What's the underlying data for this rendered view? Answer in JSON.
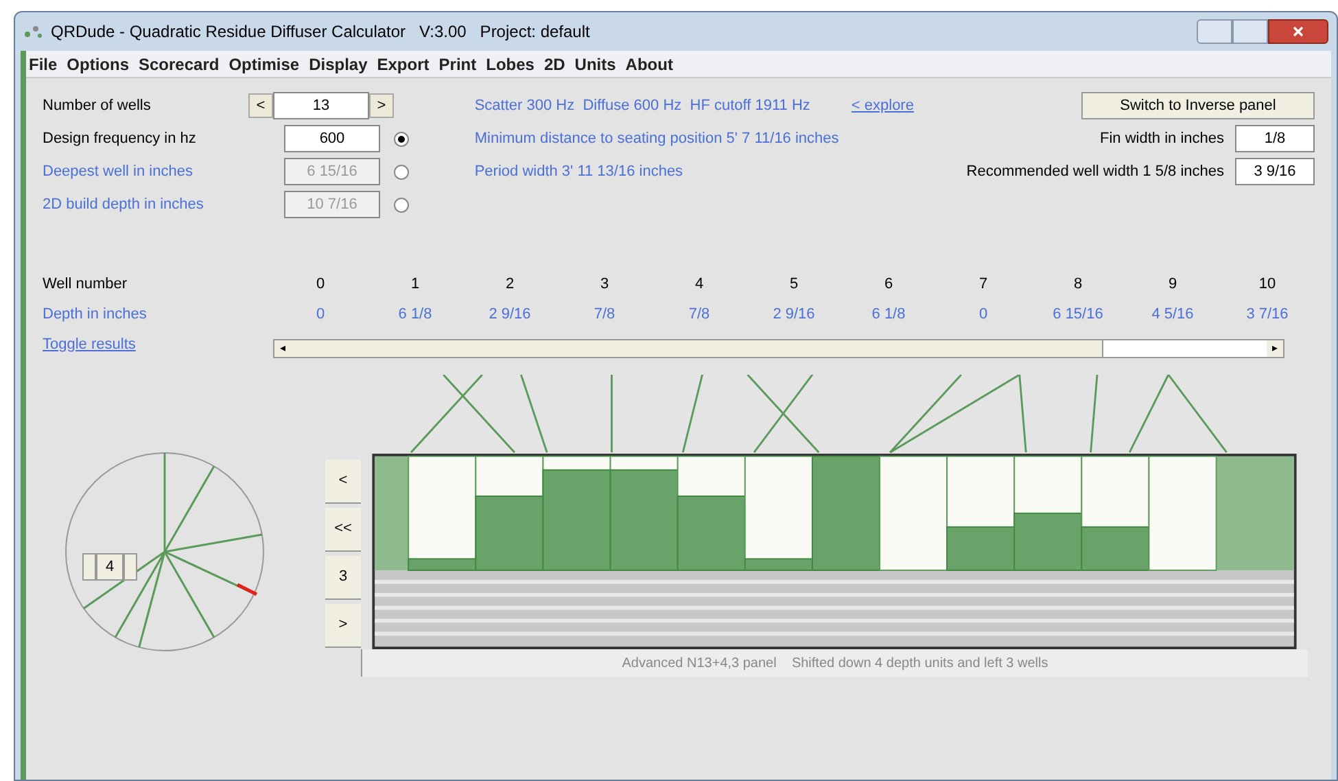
{
  "window": {
    "title": "QRDude - Quadratic Residue Diffuser Calculator   V:3.00   Project: default"
  },
  "menu": [
    "File",
    "Options",
    "Scorecard",
    "Optimise",
    "Display",
    "Export",
    "Print",
    "Lobes",
    "2D",
    "Units",
    "About"
  ],
  "fields": [
    {
      "kind": "spinner",
      "label": "Number of wells",
      "value": "13",
      "dec": "<",
      "inc": ">"
    },
    {
      "kind": "radio",
      "label": "Design frequency in hz",
      "value": "600",
      "selected": true,
      "disabled": false
    },
    {
      "kind": "radio",
      "label": "Deepest well in inches",
      "value": "6 15/16",
      "selected": false,
      "disabled": true
    },
    {
      "kind": "radio",
      "label": "2D build depth in inches",
      "value": "10 7/16",
      "selected": false,
      "disabled": true
    }
  ],
  "info": {
    "frequencies": "Scatter 300 Hz  Diffuse 600 Hz  HF cutoff 1911 Hz",
    "explore_link": "< explore",
    "min_distance": "Minimum distance to seating position 5' 7 11/16 inches",
    "period_width": "Period width 3' 11 13/16 inches"
  },
  "switch_button": "Switch to Inverse panel",
  "fin_width": {
    "label": "Fin width in inches",
    "value": "1/8"
  },
  "well_width": {
    "label": "Recommended well width 1 5/8 inches",
    "value": "3 9/16"
  },
  "wells": {
    "number_label": "Well number",
    "depth_label": "Depth in inches",
    "items": [
      {
        "number": "0",
        "depth": "0"
      },
      {
        "number": "1",
        "depth": "6 1/8"
      },
      {
        "number": "2",
        "depth": "2 9/16"
      },
      {
        "number": "3",
        "depth": "7/8"
      },
      {
        "number": "4",
        "depth": "7/8"
      },
      {
        "number": "5",
        "depth": "2 9/16"
      },
      {
        "number": "6",
        "depth": "6 1/8"
      },
      {
        "number": "7",
        "depth": "0"
      },
      {
        "number": "8",
        "depth": "6 15/16"
      },
      {
        "number": "9",
        "depth": "4 5/16"
      },
      {
        "number": "10",
        "depth": "3 7/16"
      }
    ]
  },
  "toggle_link": "Toggle results",
  "scroll_buttons": {
    "left": "◂",
    "right": "▸"
  },
  "wheel": {
    "value": "4"
  },
  "shift_buttons": [
    "<",
    "<<",
    "3",
    ">"
  ],
  "caption": "Advanced N13+4,3 panel    Shifted down 4 depth units and left 3 wells"
}
